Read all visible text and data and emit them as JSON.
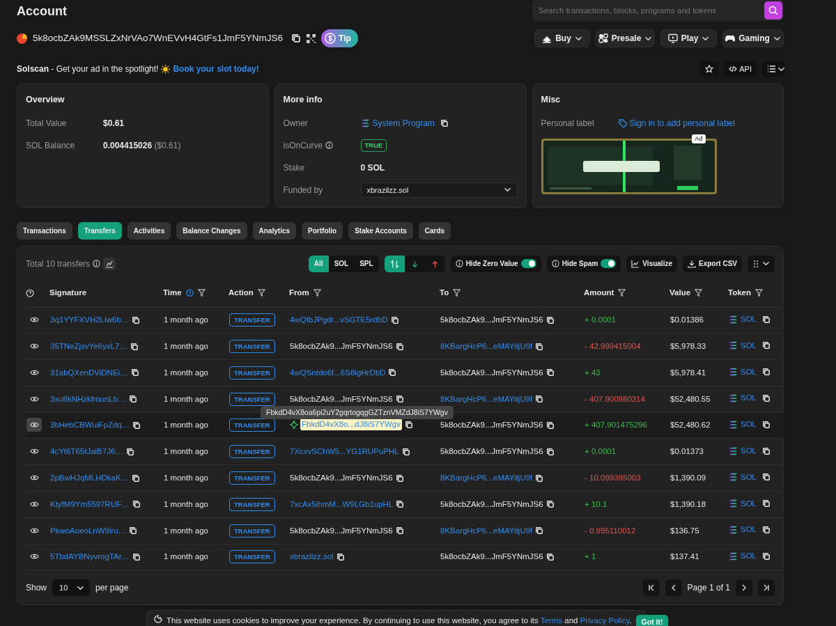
{
  "page": {
    "title": "Account"
  },
  "search": {
    "placeholder": "Search transactions, blocks, programs and tokens"
  },
  "account": {
    "address": "5k8ocbZAk9MSSLZxNrVAo7WnEVvH4GtFs1JmF5YNmJS6",
    "tip": "Tip"
  },
  "menus": [
    {
      "label": "Buy",
      "kind": "buy"
    },
    {
      "label": "Presale",
      "kind": "presale"
    },
    {
      "label": "Play",
      "kind": "play"
    },
    {
      "label": "Gaming",
      "kind": "gaming"
    }
  ],
  "promo": {
    "brand": "Solscan",
    "text": " - Get your ad in the spotlight! ",
    "link": "Book your slot today!"
  },
  "tools": {
    "api": "API"
  },
  "overview": {
    "title": "Overview",
    "fields": [
      {
        "label": "Total Value",
        "value": "$0.61"
      },
      {
        "label": "SOL Balance",
        "value": "0.004415026",
        "note": "($0.61)"
      }
    ]
  },
  "more_info": {
    "title": "More info",
    "fields": [
      {
        "label": "Owner",
        "value": "System Program",
        "kind": "link"
      },
      {
        "label": "isOnCurve",
        "value": "TRUE",
        "kind": "badge",
        "info": true
      },
      {
        "label": "Stake",
        "value": "0 SOL",
        "kind": "text"
      },
      {
        "label": "Funded by",
        "value": "xbrazilzz.sol",
        "kind": "select"
      }
    ]
  },
  "misc": {
    "title": "Misc",
    "label": "Personal label",
    "link": "Sign in to add personal label",
    "ad": {
      "kind": "picture",
      "badge": "Ad"
    }
  },
  "tabs": [
    {
      "label": "Transactions",
      "selected": false
    },
    {
      "label": "Transfers",
      "selected": true
    },
    {
      "label": "Activities",
      "selected": false
    },
    {
      "label": "Balance Changes",
      "selected": false
    },
    {
      "label": "Analytics",
      "selected": false
    },
    {
      "label": "Portfolio",
      "selected": false
    },
    {
      "label": "Stake Accounts",
      "selected": false
    },
    {
      "label": "Cards",
      "selected": false
    }
  ],
  "transfers": {
    "total": "Total 10 transfers",
    "filters": [
      {
        "label": "All",
        "selected": true
      },
      {
        "label": "SOL",
        "selected": false
      },
      {
        "label": "SPL",
        "selected": false
      }
    ],
    "directions": [
      {
        "kind": "both",
        "selected": true
      },
      {
        "kind": "in",
        "selected": false
      },
      {
        "kind": "out",
        "selected": false
      }
    ],
    "toggles": [
      {
        "label": "Hide Zero Value",
        "on": true
      },
      {
        "label": "Hide Spam",
        "on": true
      }
    ],
    "actions": [
      {
        "label": "Visualize",
        "kind": "chart"
      },
      {
        "label": "Export CSV",
        "kind": "export"
      }
    ],
    "columns": [
      {
        "label": "Signature",
        "filter": false,
        "clock": false
      },
      {
        "label": "Time",
        "filter": true,
        "clock": true
      },
      {
        "label": "Action",
        "filter": true,
        "clock": false
      },
      {
        "label": "From",
        "filter": true,
        "clock": false
      },
      {
        "label": "To",
        "filter": true,
        "clock": false
      },
      {
        "label": "Amount",
        "filter": true,
        "clock": false
      },
      {
        "label": "Value",
        "filter": true,
        "clock": false
      },
      {
        "label": "Token",
        "filter": true,
        "clock": false
      }
    ],
    "rows": [
      {
        "signature": "3q1YYFXVH2Liw6b…",
        "time": "1 month ago",
        "action": "TRANSFER",
        "from": {
          "text": "4wQtbJPgdr...vSGTE5rdbD",
          "link": true,
          "highlighted": false
        },
        "to": {
          "text": "5k8ocbZAk9...JmF5YNmJS6",
          "link": false
        },
        "amount": "+ 0.0001",
        "color": "#3fb950",
        "value": "$0.01386",
        "token": "SOL",
        "hovered": false
      },
      {
        "signature": "35TNeZjsvYe6yxL7…",
        "time": "1 month ago",
        "action": "TRANSFER",
        "from": {
          "text": "5k8ocbZAk9...JmF5YNmJS6",
          "link": false,
          "highlighted": false
        },
        "to": {
          "text": "8KBargHcP6...eMAYitjU9f",
          "link": true
        },
        "amount": "- 42.999415004",
        "color": "#e5534b",
        "value": "$5,978.33",
        "token": "SOL",
        "hovered": false
      },
      {
        "signature": "31abQXenDViDNEi…",
        "time": "1 month ago",
        "action": "TRANSFER",
        "from": {
          "text": "4wQSntdo6f...6S8igHrDbD",
          "link": true,
          "highlighted": false
        },
        "to": {
          "text": "5k8ocbZAk9...JmF5YNmJS6",
          "link": false
        },
        "amount": "+ 43",
        "color": "#3fb950",
        "value": "$5,978.41",
        "token": "SOL",
        "hovered": false
      },
      {
        "signature": "3xu8kNHzkfmunLb…",
        "time": "1 month ago",
        "action": "TRANSFER",
        "from": {
          "text": "5k8ocbZAk9...JmF5YNmJS6",
          "link": false,
          "highlighted": false
        },
        "to": {
          "text": "8KBargHcP6...eMAYitjU9f",
          "link": true
        },
        "amount": "- 407.900980314",
        "color": "#e5534b",
        "value": "$52,480.55",
        "token": "SOL",
        "hovered": false
      },
      {
        "signature": "3bHebCBWuiFpZdq…",
        "time": "1 month ago",
        "action": "TRANSFER",
        "from": {
          "text": "FbkdD4vX8o...dJ8iS7YWgv",
          "link": true,
          "highlighted": true,
          "tooltip": "FbkdD4vX8oa6pi2uY2gqrtogqgGZTznVMZdJ8iS7YWgv"
        },
        "to": {
          "text": "5k8ocbZAk9...JmF5YNmJS6",
          "link": false
        },
        "amount": "+ 407.901475296",
        "color": "#3fb950",
        "value": "$52,480.62",
        "token": "SOL",
        "hovered": true
      },
      {
        "signature": "4cYt6T65tJaiB7J6…",
        "time": "1 month ago",
        "action": "TRANSFER",
        "from": {
          "text": "7XcxvSChW5...YG1RUPuPHL",
          "link": true,
          "highlighted": false
        },
        "to": {
          "text": "5k8ocbZAk9...JmF5YNmJS6",
          "link": false
        },
        "amount": "+ 0.0001",
        "color": "#3fb950",
        "value": "$0.01373",
        "token": "SOL",
        "hovered": false
      },
      {
        "signature": "2pBwHJqMLHDkaK…",
        "time": "1 month ago",
        "action": "TRANSFER",
        "from": {
          "text": "5k8ocbZAk9...JmF5YNmJS6",
          "link": false,
          "highlighted": false
        },
        "to": {
          "text": "8KBargHcP6...eMAYitjU9f",
          "link": true
        },
        "amount": "- 10.099395003",
        "color": "#e5534b",
        "value": "$1,390.09",
        "token": "SOL",
        "hovered": false
      },
      {
        "signature": "KtyfM9Ym5597RUF…",
        "time": "1 month ago",
        "action": "TRANSFER",
        "from": {
          "text": "7xcAx5ihmM...W9LGb1upHL",
          "link": true,
          "highlighted": false
        },
        "to": {
          "text": "5k8ocbZAk9...JmF5YNmJS6",
          "link": false
        },
        "amount": "+ 10.1",
        "color": "#3fb950",
        "value": "$1,390.18",
        "token": "SOL",
        "hovered": false
      },
      {
        "signature": "PkwoAoeoLnW9iru…",
        "time": "1 month ago",
        "action": "TRANSFER",
        "from": {
          "text": "5k8ocbZAk9...JmF5YNmJS6",
          "link": false,
          "highlighted": false
        },
        "to": {
          "text": "8KBargHcP6...eMAYitjU9f",
          "link": true
        },
        "amount": "- 0.995110012",
        "color": "#e5534b",
        "value": "$136.75",
        "token": "SOL",
        "hovered": false
      },
      {
        "signature": "5TbdAYBNyvrogTAr…",
        "time": "1 month ago",
        "action": "TRANSFER",
        "from": {
          "text": "xbrazilzz.sol",
          "link": true,
          "highlighted": false
        },
        "to": {
          "text": "5k8ocbZAk9...JmF5YNmJS6",
          "link": false
        },
        "amount": "+ 1",
        "color": "#3fb950",
        "value": "$137.41",
        "token": "SOL",
        "hovered": false
      }
    ],
    "pagination": {
      "show": "Show",
      "per_page_value": "10",
      "per_page": "per page",
      "page": "Page 1 of 1"
    }
  },
  "cookie": {
    "text": "This website uses cookies to improve your experience. By continuing to use this website, you agree to its",
    "terms": "Terms",
    "and": "and",
    "privacy": "Privacy Policy",
    "end": ".",
    "button": "Got it!"
  }
}
